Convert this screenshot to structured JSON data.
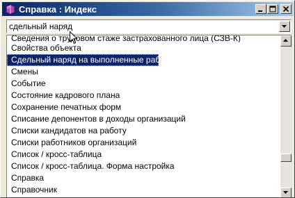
{
  "window": {
    "title": "Справка : Индекс"
  },
  "search": {
    "value": "сдельный наряд"
  },
  "index": {
    "selected_index": 2,
    "items": [
      "Сведения о трудовом стаже застрахованного лица (СЗВ-К)",
      "Свойства объекта",
      "Сдельный наряд на выполненные работы",
      "Смены",
      "Событие",
      "Состояние кадрового плана",
      "Сохранение печатных форм",
      "Списание депонентов в доходы организаций",
      "Списки кандидатов на работу",
      "Списки работников организаций",
      "Список / кросс-таблица",
      "Список / кросс-таблица. Форма настройка",
      "Справка",
      "Справочник"
    ]
  },
  "icons": {
    "window": "help-book-icon",
    "minimize": "minimize-icon",
    "maximize": "maximize-icon",
    "close": "close-icon",
    "dropdown": "chevron-down-icon",
    "scroll_up": "arrow-up-icon",
    "scroll_down": "arrow-down-icon",
    "cursor": "mouse-pointer-icon"
  },
  "colors": {
    "title_start": "#0a246a",
    "title_end": "#a6caf0",
    "selection": "#0a246a",
    "face": "#d4d0c8"
  }
}
